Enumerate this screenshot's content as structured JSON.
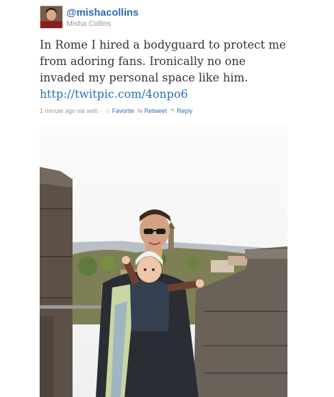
{
  "tweet": {
    "handle": "@mishacollins",
    "display_name": "Misha Collins",
    "text_lines": [
      "In Rome I hired a bodyguard to protect me",
      "from adoring fans. Ironically no one",
      "invaded my personal space like him."
    ],
    "link": "http://twitpic.com/4onpo6",
    "timestamp": "1 minute ago",
    "source": "via web",
    "separator": "·",
    "actions": {
      "favorite": "Favorite",
      "retweet": "Retweet",
      "reply": "Reply"
    }
  },
  "icons": {
    "favorite": "star-icon",
    "retweet": "retweet-icon",
    "reply": "reply-icon"
  },
  "colors": {
    "link": "#2a6fb5",
    "meta_text": "#999999",
    "tweet_text": "#333333"
  }
}
